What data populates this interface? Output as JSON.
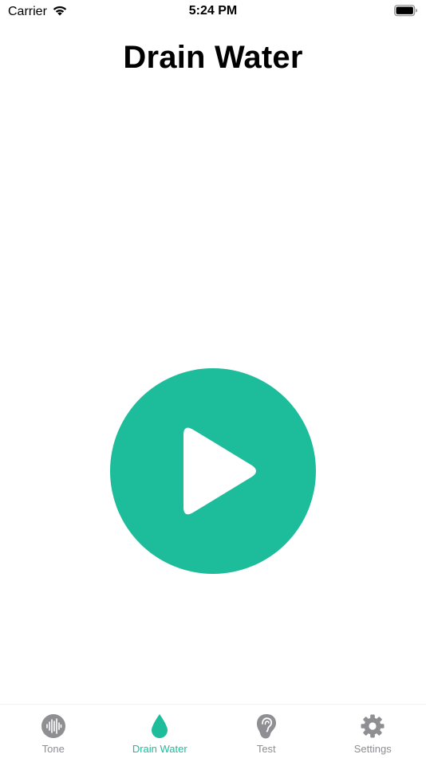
{
  "status_bar": {
    "carrier": "Carrier",
    "time": "5:24 PM"
  },
  "page": {
    "title": "Drain Water"
  },
  "tabs": [
    {
      "label": "Tone",
      "icon": "waveform-icon",
      "active": false
    },
    {
      "label": "Drain Water",
      "icon": "water-drop-icon",
      "active": true
    },
    {
      "label": "Test",
      "icon": "ear-icon",
      "active": false
    },
    {
      "label": "Settings",
      "icon": "gear-icon",
      "active": false
    }
  ],
  "colors": {
    "accent": "#1dbc9b",
    "inactive": "#8e8e93"
  }
}
